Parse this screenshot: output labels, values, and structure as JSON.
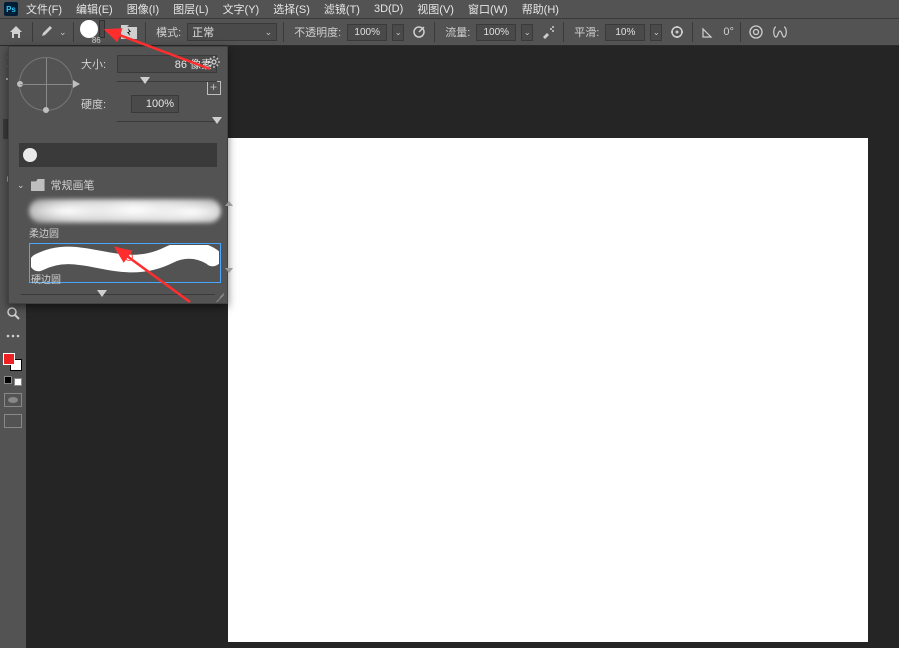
{
  "menu": {
    "items": [
      "文件(F)",
      "编辑(E)",
      "图像(I)",
      "图层(L)",
      "文字(Y)",
      "选择(S)",
      "滤镜(T)",
      "3D(D)",
      "视图(V)",
      "窗口(W)",
      "帮助(H)"
    ]
  },
  "options": {
    "brush_size_label": "86",
    "mode_label": "模式:",
    "mode_value": "正常",
    "opacity_label": "不透明度:",
    "opacity_value": "100%",
    "flow_label": "流量:",
    "flow_value": "100%",
    "smoothing_label": "平滑:",
    "smoothing_value": "10%",
    "angle_value": "0°"
  },
  "brush_panel": {
    "size_label": "大小:",
    "size_value": "86 像素",
    "hardness_label": "硬度:",
    "hardness_value": "100%",
    "group_label": "常规画笔",
    "preset_soft": "柔边圆",
    "preset_hard": "硬边圆"
  }
}
